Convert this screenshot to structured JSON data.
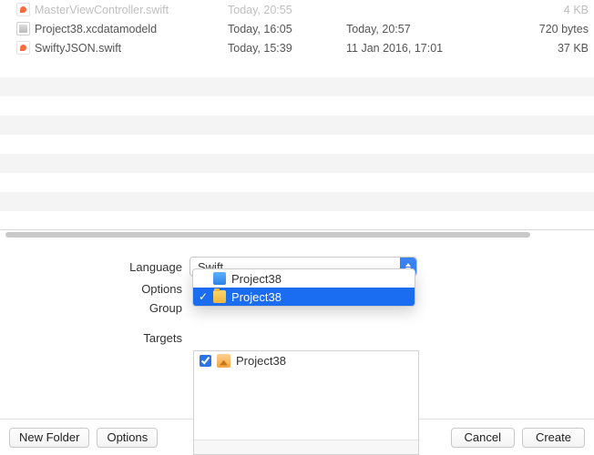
{
  "files": [
    {
      "name": "MasterViewController.swift",
      "date1": "Today, 20:55",
      "date2": "",
      "size": "4 KB",
      "faded": true,
      "icon": "swift"
    },
    {
      "name": "Project38.xcdatamodeld",
      "date1": "Today, 16:05",
      "date2": "Today, 20:57",
      "size": "720 bytes",
      "faded": false,
      "icon": "model"
    },
    {
      "name": "SwiftyJSON.swift",
      "date1": "Today, 15:39",
      "date2": "11 Jan 2016, 17:01",
      "size": "37 KB",
      "faded": false,
      "icon": "swift"
    }
  ],
  "form": {
    "language_label": "Language",
    "language_value": "Swift",
    "options_label": "Options",
    "group_label": "Group",
    "targets_label": "Targets"
  },
  "group_popup": {
    "items": [
      {
        "label": "Project38",
        "icon": "proj",
        "selected": false
      },
      {
        "label": "Project38",
        "icon": "folder",
        "selected": true
      }
    ]
  },
  "targets": [
    {
      "label": "Project38",
      "checked": true
    }
  ],
  "buttons": {
    "new_folder": "New Folder",
    "options": "Options",
    "cancel": "Cancel",
    "create": "Create"
  }
}
